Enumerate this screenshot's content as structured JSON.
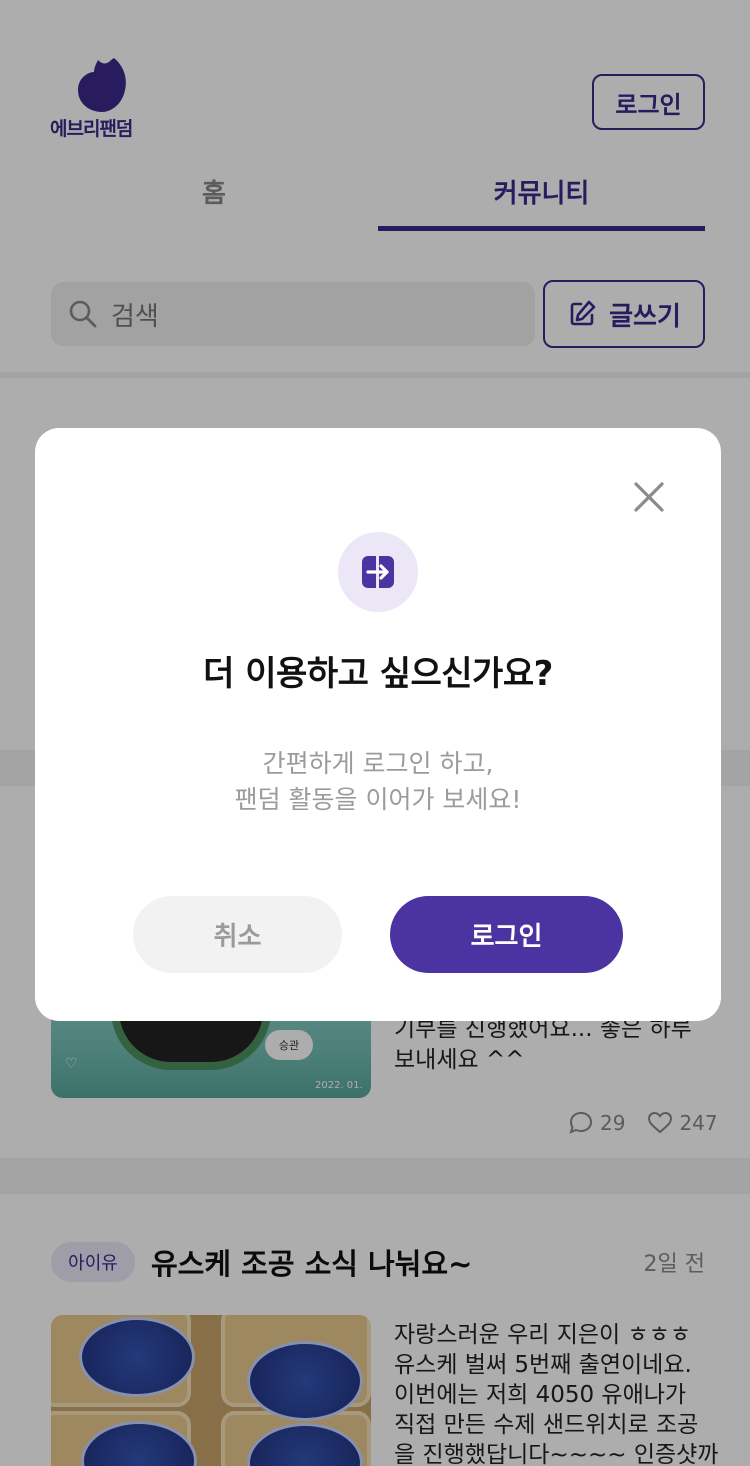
{
  "header": {
    "brand_name": "에브리팬덤",
    "login_label": "로그인"
  },
  "tabs": [
    {
      "label": "홈",
      "active": false
    },
    {
      "label": "커뮤니티",
      "active": true
    }
  ],
  "search": {
    "placeholder": "검색"
  },
  "write_button_label": "글쓰기",
  "posts": [
    {
      "text_lines": [
        "기부를 진행했어요... 좋은 하루",
        "보내세요 ^^"
      ],
      "comments": "29",
      "likes": "247",
      "thumb_chip": "승관",
      "thumb_date": "2022. 01."
    },
    {
      "tag": "아이유",
      "title": "유스케 조공 소식 나눠요~",
      "time": "2일 전",
      "text_lines": [
        "자랑스러운 우리 지은이 ㅎㅎㅎ",
        "유스케 벌써 5번째 출연이네요.",
        "이번에는 저희 4050 유애나가",
        "직접 만든 수제 샌드위치로 조공",
        "을 진행했답니다~~~~ 인증샷까"
      ]
    }
  ],
  "modal": {
    "title": "더 이용하고 싶으신가요?",
    "desc_line1": "간편하게 로그인 하고,",
    "desc_line2": "팬덤 활동을 이어가 보세요!",
    "cancel_label": "취소",
    "confirm_label": "로그인"
  },
  "colors": {
    "brand": "#3b2a8c",
    "primary_button": "#4b34a1",
    "icon_bg": "#ebe7f6",
    "muted_text": "#9b9b9b"
  }
}
